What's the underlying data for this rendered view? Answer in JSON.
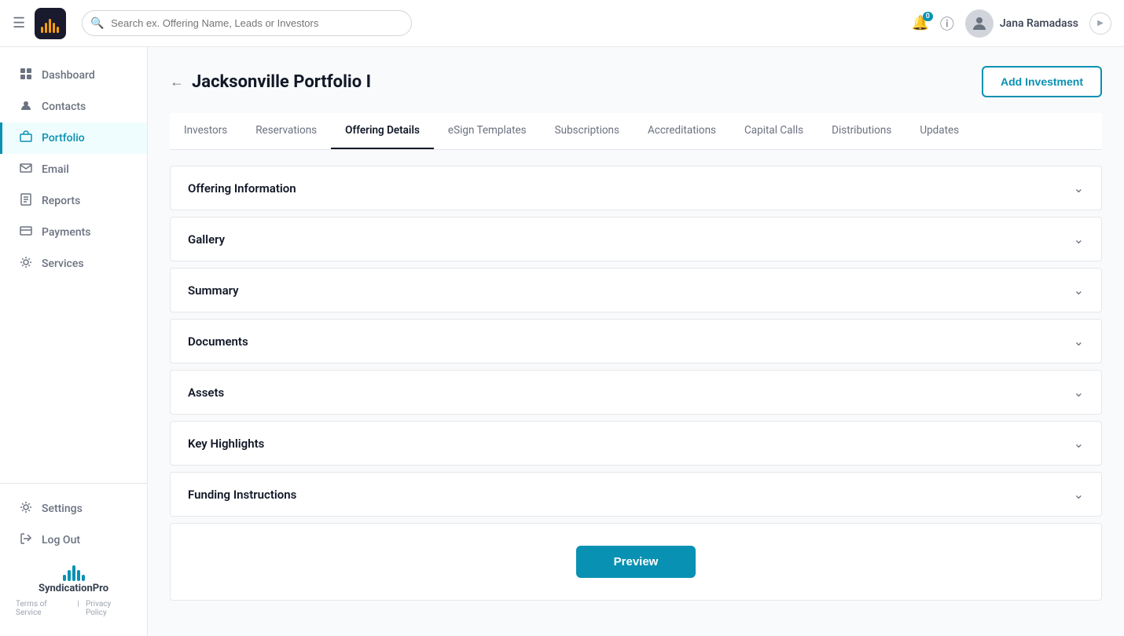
{
  "topnav": {
    "search_placeholder": "Search ex. Offering Name, Leads or Investors",
    "username": "Jana Ramadass",
    "notification_count": "0"
  },
  "sidebar": {
    "items": [
      {
        "id": "dashboard",
        "label": "Dashboard",
        "icon": "⌂",
        "active": false
      },
      {
        "id": "contacts",
        "label": "Contacts",
        "icon": "👤",
        "active": false
      },
      {
        "id": "portfolio",
        "label": "Portfolio",
        "icon": "📊",
        "active": true
      },
      {
        "id": "email",
        "label": "Email",
        "icon": "✉",
        "active": false
      },
      {
        "id": "reports",
        "label": "Reports",
        "icon": "🖨",
        "active": false
      },
      {
        "id": "payments",
        "label": "Payments",
        "icon": "💳",
        "active": false
      },
      {
        "id": "services",
        "label": "Services",
        "icon": "⚙",
        "active": false
      }
    ],
    "bottom_items": [
      {
        "id": "settings",
        "label": "Settings",
        "icon": "⚙"
      },
      {
        "id": "logout",
        "label": "Log Out",
        "icon": "↩"
      }
    ],
    "footer": {
      "terms": "Terms of Service",
      "privacy": "Privacy Policy",
      "separator": "|"
    }
  },
  "page": {
    "title": "Jacksonville Portfolio I",
    "add_investment_label": "Add Investment",
    "back_label": "←"
  },
  "tabs": [
    {
      "id": "investors",
      "label": "Investors",
      "active": false
    },
    {
      "id": "reservations",
      "label": "Reservations",
      "active": false
    },
    {
      "id": "offering-details",
      "label": "Offering Details",
      "active": true
    },
    {
      "id": "esign-templates",
      "label": "eSign Templates",
      "active": false
    },
    {
      "id": "subscriptions",
      "label": "Subscriptions",
      "active": false
    },
    {
      "id": "accreditations",
      "label": "Accreditations",
      "active": false
    },
    {
      "id": "capital-calls",
      "label": "Capital Calls",
      "active": false
    },
    {
      "id": "distributions",
      "label": "Distributions",
      "active": false
    },
    {
      "id": "updates",
      "label": "Updates",
      "active": false
    }
  ],
  "accordion_sections": [
    {
      "id": "offering-information",
      "title": "Offering Information"
    },
    {
      "id": "gallery",
      "title": "Gallery"
    },
    {
      "id": "summary",
      "title": "Summary"
    },
    {
      "id": "documents",
      "title": "Documents"
    },
    {
      "id": "assets",
      "title": "Assets"
    },
    {
      "id": "key-highlights",
      "title": "Key Highlights"
    },
    {
      "id": "funding-instructions",
      "title": "Funding Instructions"
    }
  ],
  "preview_button_label": "Preview",
  "brand": {
    "name_line1": "Syndication",
    "name_line2": "Pro"
  }
}
